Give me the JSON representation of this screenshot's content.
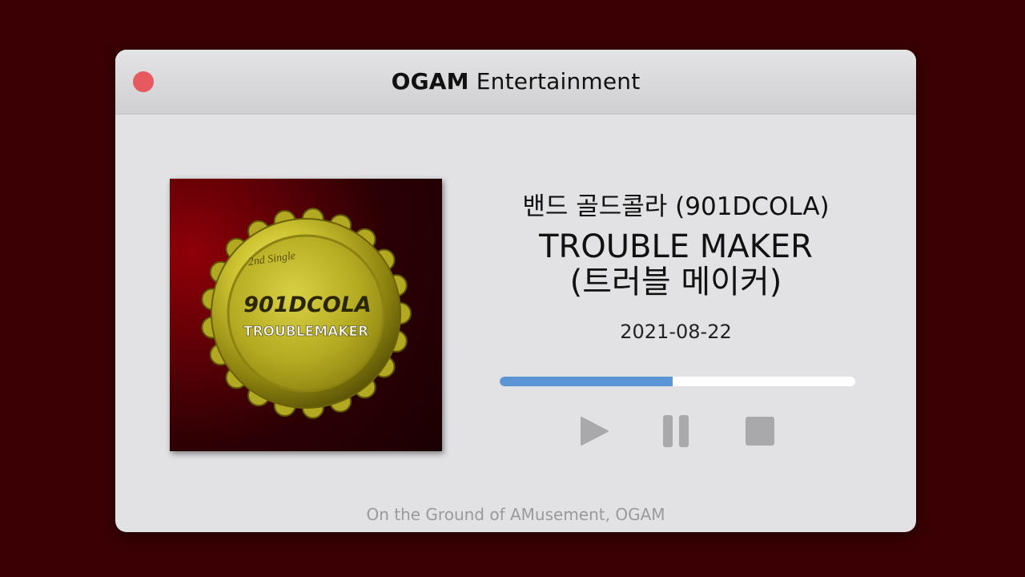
{
  "window": {
    "title_brand": "OGAM",
    "title_rest": " Entertainment",
    "footer": "On the Ground of AMusement, OGAM"
  },
  "album": {
    "cover_icon": "bottle-cap-album-art",
    "cover_text_top": "2nd Single",
    "cover_text_main": "901DCOLA",
    "cover_text_sub": "TROUBLEMAKER"
  },
  "track": {
    "artist": "밴드 골드콜라 (901DCOLA)",
    "title_line1": "TROUBLE MAKER",
    "title_line2": "(트러블 메이커)",
    "date": "2021-08-22"
  },
  "player": {
    "progress_fraction": 0.486,
    "controls": [
      {
        "name": "play",
        "icon": "play-icon"
      },
      {
        "name": "pause",
        "icon": "pause-icon"
      },
      {
        "name": "stop",
        "icon": "stop-icon"
      }
    ]
  },
  "colors": {
    "background": "#3a0004",
    "window": "#e2e2e4",
    "close_dot": "#e65a5f",
    "progress": "#5b95d6",
    "controls": "#a9a9ab"
  }
}
